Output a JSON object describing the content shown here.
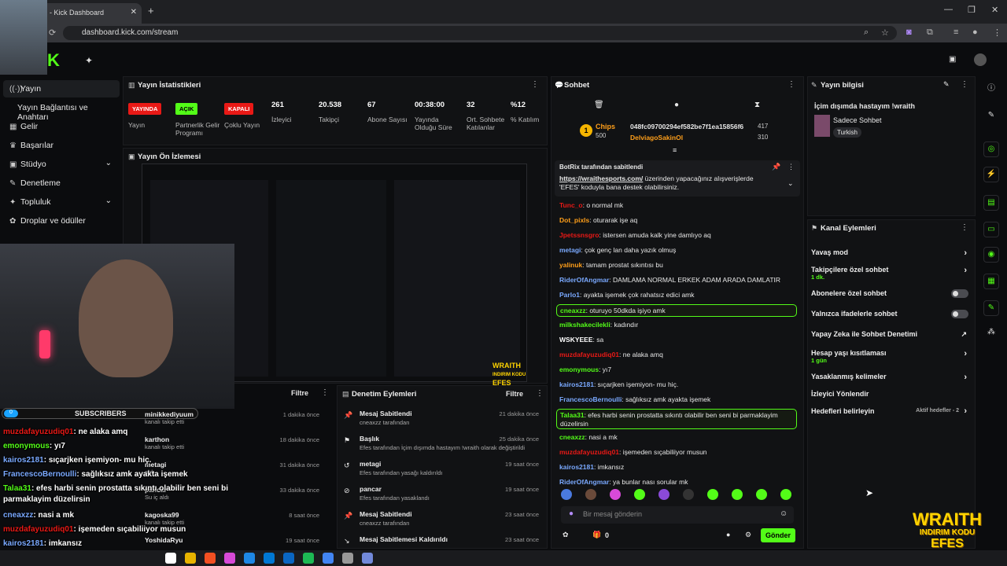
{
  "browser": {
    "tab_title": "am - Kick Dashboard",
    "url": "dashboard.kick.com/stream"
  },
  "sidebar": {
    "items": [
      {
        "label": "Yayın",
        "icon": "broadcast-icon",
        "active": true
      },
      {
        "label": "Yayın Bağlantısı ve Anahtarı",
        "icon": ""
      },
      {
        "label": "Gelir",
        "icon": "dollar-icon"
      },
      {
        "label": "Başarılar",
        "icon": "trophy-icon"
      },
      {
        "label": "Stüdyo",
        "icon": "studio-icon",
        "chev": "⌄"
      },
      {
        "label": "Denetleme",
        "icon": "wrench-icon"
      },
      {
        "label": "Topluluk",
        "icon": "community-icon",
        "chev": "⌄"
      },
      {
        "label": "Droplar ve ödüller",
        "icon": "gift-icon"
      }
    ]
  },
  "stats": {
    "title": "Yayın İstatistikleri",
    "items": [
      {
        "badge": "YAYINDA",
        "badge_color": "#e91916",
        "label": "Yayın"
      },
      {
        "badge": "AÇIK",
        "badge_color": "#53fc18",
        "label": "Partnerlik Gelir Programı"
      },
      {
        "badge": "KAPALI",
        "badge_color": "#e91916",
        "label": "Çoklu Yayın"
      },
      {
        "value": "261",
        "label": "İzleyici"
      },
      {
        "value": "20.538",
        "label": "Takipçi"
      },
      {
        "value": "67",
        "label": "Abone Sayısı"
      },
      {
        "value": "00:38:00",
        "label": "Yayında Olduğu Süre"
      },
      {
        "value": "32",
        "label": "Ort. Sohbete Katılanlar"
      },
      {
        "value": "%12",
        "label": "% Katılım"
      }
    ]
  },
  "preview": {
    "title": "Yayın Ön İzlemesi",
    "wraith": "WRAITH\nINDIRIM KODU\nEFES"
  },
  "overlay": {
    "subscribers": "SUBSCRIBERS",
    "sub_count": "0",
    "messages": [
      {
        "user": "muzdafayuzudiq01",
        "color": "#e91916",
        "text": ": ne alaka amq"
      },
      {
        "user": "emonymous",
        "color": "#53fc18",
        "text": ": yı7"
      },
      {
        "user": "kairos2181",
        "color": "#7aa9ff",
        "text": ": sıçarjken işemiyon- mu hiç."
      },
      {
        "user": "FrancescoBernoulli",
        "color": "#7aa9ff",
        "text": ": sağlıksız amk ayakta işemek"
      },
      {
        "user": "Talaa31",
        "color": "#53fc18",
        "text": ": efes harbi senin prostatta sıkıntı olabilir ben seni bi"
      },
      {
        "user": "",
        "color": "#fff",
        "text": "parmaklayim düzelirsin"
      },
      {
        "user": "cneaxzz",
        "color": "#7aa9ff",
        "text": ": nasi a mk"
      },
      {
        "user": "muzdafayuzudiq01",
        "color": "#e91916",
        "text": ": işemeden sıçabiliiyor musun"
      },
      {
        "user": "kairos2181",
        "color": "#7aa9ff",
        "text": ": imkansız"
      },
      {
        "user": "RiderOfAngmar",
        "color": "#7aa9ff",
        "text": ": ya bunlar nası sorular mk"
      }
    ]
  },
  "followers": {
    "filter": "Filtre",
    "items": [
      {
        "name": "minikkediyuum",
        "sub": "kanalı takip etti",
        "time": "1 dakika önce"
      },
      {
        "name": "karthon",
        "sub": "kanalı takip etti",
        "time": "18 dakika önce"
      },
      {
        "name": "metagi",
        "sub": "aldı",
        "time": "31 dakika önce"
      },
      {
        "name": "pancar",
        "sub": "Su iç aldı",
        "time": "33 dakika önce"
      },
      {
        "name": "kagoska99",
        "sub": "kanalı takip etti",
        "time": "8 saat önce"
      },
      {
        "name": "YoshidaRyu",
        "sub": "",
        "time": "19 saat önce"
      }
    ]
  },
  "modactions": {
    "title": "Denetim Eylemleri",
    "filter": "Filtre",
    "items": [
      {
        "icon": "pin-icon",
        "title": "Mesaj Sabitlendi",
        "sub": "cneaxzz tarafından",
        "time": "21 dakika önce"
      },
      {
        "icon": "flag-icon",
        "title": "Başlık",
        "sub": "Efes tarafından İçim dışımda hastayım !wraith olarak değiştirildi",
        "time": "25 dakika önce"
      },
      {
        "icon": "undo-icon",
        "title": "metagi",
        "sub": "Efes tarafından yasağı kaldırıldı",
        "time": "19 saat önce"
      },
      {
        "icon": "ban-icon",
        "title": "pancar",
        "sub": "Efes tarafından yasaklandı",
        "time": "19 saat önce"
      },
      {
        "icon": "pin-icon",
        "title": "Mesaj Sabitlendi",
        "sub": "cneaxzz tarafından",
        "time": "23 saat önce"
      },
      {
        "icon": "unpin-icon",
        "title": "Mesaj Sabitlemesi Kaldırıldı",
        "sub": "",
        "time": "23 saat önce"
      }
    ]
  },
  "chat": {
    "title": "Sohbet",
    "chips_label": "Chips",
    "chips_val": "500",
    "top1": "048fc09700294ef582be7f1ea15856f6",
    "top1_val": "417",
    "top2": "DelviagoSakinOl",
    "top2_val": "310",
    "pinned_by": "BotRix tarafından sabitlendi",
    "pinned_link": "https://wraithesports.com/",
    "pinned_text": " üzerinden yapacağınız alışverişlerde 'EFES' koduyla bana destek olabilirsiniz.",
    "messages": [
      {
        "user": "Tunc_o",
        "color": "#e91916",
        "text": ": o normal mk"
      },
      {
        "user": "Dot_pixls",
        "color": "#ff9f1a",
        "text": ": oturarak işe aq"
      },
      {
        "user": "Jpetssnsgro",
        "color": "#e91916",
        "text": ": istersen amuda kalk yine damlıyo aq"
      },
      {
        "user": "metagi",
        "color": "#7aa9ff",
        "text": ": çok genç lan daha yazık olmuş"
      },
      {
        "user": "yalinuk",
        "color": "#ff9f1a",
        "text": ": tamam prostat sıkıntısı bu"
      },
      {
        "user": "RiderOfAngmar",
        "color": "#7aa9ff",
        "text": ": DAMLAMA NORMAL ERKEK ADAM ARADA DAMLATIR"
      },
      {
        "user": "Parlo1",
        "color": "#7aa9ff",
        "text": ": ayakta işemek çok rahatsız edici amk"
      },
      {
        "user": "cneaxzz",
        "color": "#53fc18",
        "text": ": oturuyo 50dkda işiyo amk",
        "hl": true
      },
      {
        "user": "milkshakecilekli",
        "color": "#53fc18",
        "text": ": kadındır"
      },
      {
        "user": "WSKYEEE",
        "color": "#fff",
        "text": ": sa"
      },
      {
        "user": "muzdafayuzudiq01",
        "color": "#e91916",
        "text": ": ne alaka amq"
      },
      {
        "user": "emonymous",
        "color": "#53fc18",
        "text": ": yı7"
      },
      {
        "user": "kairos2181",
        "color": "#7aa9ff",
        "text": ": sıçarjken işemiyon- mu hiç."
      },
      {
        "user": "FrancescoBernoulli",
        "color": "#7aa9ff",
        "text": ": sağlıksız amk ayakta işemek"
      },
      {
        "user": "Talaa31",
        "color": "#53fc18",
        "text": ": efes harbi senin prostatta sıkıntı olabilir ben seni bi parmaklayim düzelirsin",
        "hl": true
      },
      {
        "user": "cneaxzz",
        "color": "#53fc18",
        "text": ": nasi a mk"
      },
      {
        "user": "muzdafayuzudiq01",
        "color": "#e91916",
        "text": ": işemeden sıçabiliiyor musun"
      },
      {
        "user": "kairos2181",
        "color": "#7aa9ff",
        "text": ": imkansız"
      },
      {
        "user": "RiderOfAngmar",
        "color": "#7aa9ff",
        "text": ": ya bunlar nası sorular mk"
      }
    ],
    "placeholder": "Bir mesaj gönderin",
    "send": "Gönder",
    "count": "0"
  },
  "streaminfo": {
    "title": "Yayın bilgisi",
    "stream_title": "İçim dışımda hastayım !wraith",
    "category": "Sadece Sohbet",
    "tag": "Turkish"
  },
  "channelactions": {
    "title": "Kanal Eylemleri",
    "items": [
      {
        "label": "Yavaş mod",
        "type": "chev"
      },
      {
        "label": "Takipçilere özel sohbet",
        "sub": "1 dk.",
        "type": "chev"
      },
      {
        "label": "Abonelere özel sohbet",
        "type": "toggle"
      },
      {
        "label": "Yalnızca ifadelerle sohbet",
        "type": "toggle"
      },
      {
        "label": "Yapay Zeka ile Sohbet Denetimi",
        "type": "ext"
      },
      {
        "label": "Hesap yaşı kısıtlaması",
        "sub": "1 gün",
        "type": "chev"
      },
      {
        "label": "Yasaklanmış kelimeler",
        "type": "chev"
      },
      {
        "label": "İzleyici Yönlendir",
        "type": "none"
      },
      {
        "label": "Hedefleri belirleyin",
        "type": "goal",
        "extra": "Aktif hedefler - 2"
      }
    ]
  },
  "wraith": {
    "line1": "WRAITH",
    "line2": "INDIRIM KODU",
    "line3": "EFES"
  },
  "colors": {
    "accent": "#53fc18",
    "live": "#e91916"
  }
}
